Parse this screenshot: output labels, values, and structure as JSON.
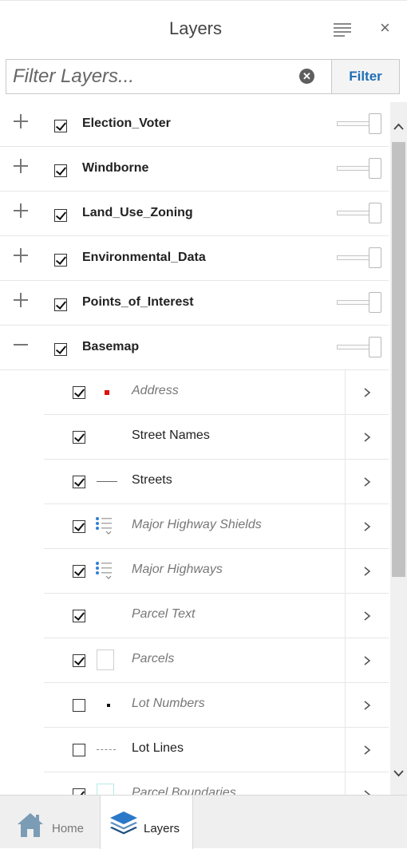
{
  "header": {
    "title": "Layers",
    "close_glyph": "×"
  },
  "filter": {
    "placeholder": "Filter Layers...",
    "value": "",
    "clear_glyph": "✕",
    "button_label": "Filter"
  },
  "layers": [
    {
      "name": "Election_Voter",
      "checked": true,
      "expanded": false
    },
    {
      "name": "Windborne",
      "checked": true,
      "expanded": false
    },
    {
      "name": "Land_Use_Zoning",
      "checked": true,
      "expanded": false
    },
    {
      "name": "Environmental_Data",
      "checked": true,
      "expanded": false
    },
    {
      "name": "Points_of_Interest",
      "checked": true,
      "expanded": false
    },
    {
      "name": "Basemap",
      "checked": true,
      "expanded": true
    }
  ],
  "basemap_sublayers": [
    {
      "name": "Address",
      "checked": true,
      "italic": true,
      "legend": "red-square-icon"
    },
    {
      "name": "Street Names",
      "checked": true,
      "italic": false,
      "legend": "none"
    },
    {
      "name": "Streets",
      "checked": true,
      "italic": false,
      "legend": "line-icon"
    },
    {
      "name": "Major Highway Shields",
      "checked": true,
      "italic": true,
      "legend": "legend-list-icon"
    },
    {
      "name": "Major Highways",
      "checked": true,
      "italic": true,
      "legend": "legend-list-icon"
    },
    {
      "name": "Parcel Text",
      "checked": true,
      "italic": true,
      "legend": "none"
    },
    {
      "name": "Parcels",
      "checked": true,
      "italic": true,
      "legend": "empty-box-icon"
    },
    {
      "name": "Lot Numbers",
      "checked": false,
      "italic": true,
      "legend": "black-dot-icon"
    },
    {
      "name": "Lot Lines",
      "checked": false,
      "italic": false,
      "legend": "dashed-line-icon"
    },
    {
      "name": "Parcel Boundaries",
      "checked": true,
      "italic": true,
      "legend": "teal-box-icon"
    }
  ],
  "footer": {
    "home_label": "Home",
    "layers_label": "Layers"
  },
  "colors": {
    "accent_blue": "#1f6fb5",
    "address_red": "#e01010",
    "legend_blue": "#2f7fd6"
  }
}
